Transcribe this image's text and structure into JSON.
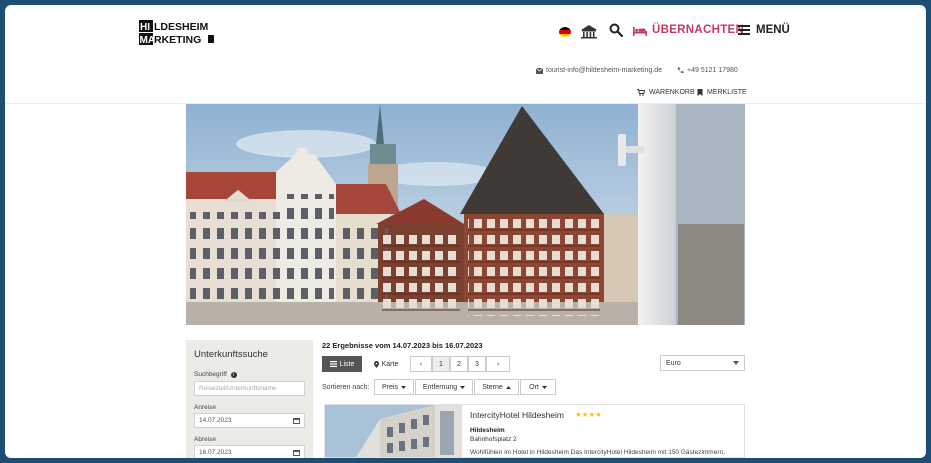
{
  "header": {
    "logo_line1": "HILDESHEIM",
    "logo_line2": "MARKETING",
    "overnight_label": "ÜBERNACHTEN",
    "menu_label": "MENÜ",
    "email": "tourist-info@hildesheim-marketing.de",
    "phone": "+49 5121 17980",
    "cart_label": "WARENKORB",
    "watchlist_label": "MERKLISTE"
  },
  "sidebar": {
    "title": "Unterkunftssuche",
    "search_label": "Suchbegriff",
    "search_placeholder": "Reiseziel/Unterkunftsname",
    "arrival_label": "Anreise",
    "arrival_value": "14.07.2023",
    "departure_label": "Abreise",
    "departure_value": "16.07.2023"
  },
  "results": {
    "summary": "22 Ergebnisse vom 14.07.2023 bis 16.07.2023",
    "view_list": "Liste",
    "view_map": "Karte",
    "pages": [
      "1",
      "2",
      "3"
    ],
    "prev": "‹",
    "next": "›",
    "currency": "Euro",
    "sort_label": "Sortieren nach:",
    "sort_options": [
      "Preis",
      "Entfernung",
      "Sterne",
      "Ort"
    ]
  },
  "hotel": {
    "name": "IntercityHotel Hildesheim",
    "stars": "★★★★",
    "city": "Hildesheim",
    "street": "Bahnhofsplatz 2",
    "description": "Wohlfühlen im Hotel in Hildesheim Das IntercityHotel Hildesheim mit 150 Gästezimmern,"
  },
  "colors": {
    "accent": "#c43a5f",
    "sidebar_bg": "#ecebe6",
    "star": "#f0c419"
  }
}
